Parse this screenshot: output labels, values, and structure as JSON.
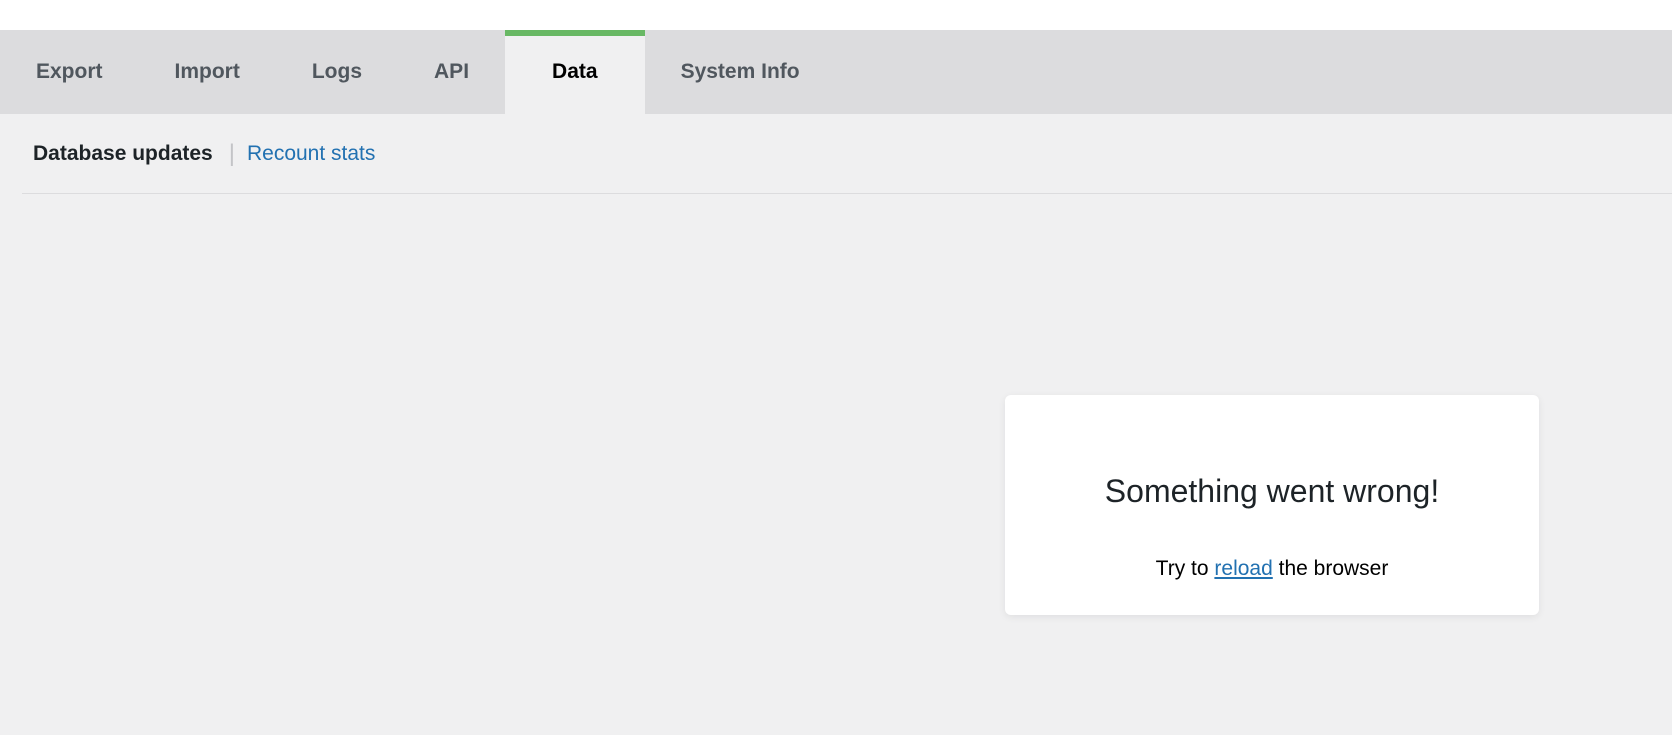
{
  "tabs": [
    {
      "label": "Export",
      "active": false
    },
    {
      "label": "Import",
      "active": false
    },
    {
      "label": "Logs",
      "active": false
    },
    {
      "label": "API",
      "active": false
    },
    {
      "label": "Data",
      "active": true
    },
    {
      "label": "System Info",
      "active": false
    }
  ],
  "subnav": {
    "current": "Database updates",
    "separator": "|",
    "link": "Recount stats"
  },
  "error": {
    "title": "Something went wrong!",
    "prefix": "Try to",
    "link": "reload",
    "suffix": "the browser"
  },
  "colors": {
    "accent": "#68b864",
    "link": "#2271b1",
    "tab_bar": "#dcdcde",
    "background": "#f0f0f1"
  }
}
